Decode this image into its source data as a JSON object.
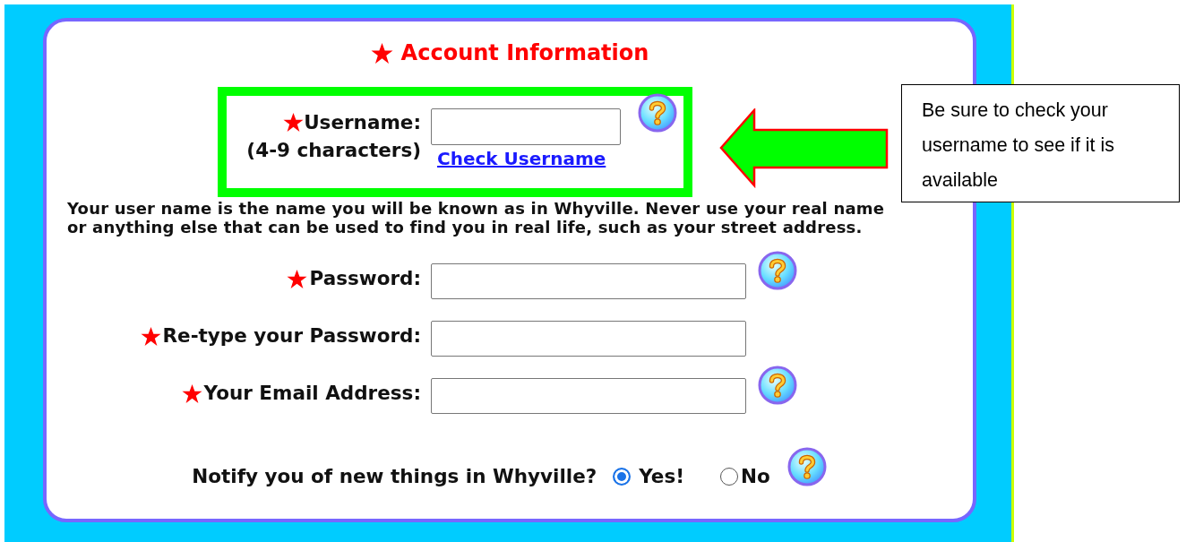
{
  "title": {
    "text": "Account Information",
    "required": true
  },
  "username": {
    "label": "Username:",
    "hint": "(4-9 characters)",
    "required": true,
    "link": "Check Username",
    "help": true
  },
  "username_note": "Your user name is the name you will be known as in Whyville. Never use your real name or anything else that can be used to find you in real life, such as your street address.",
  "fields": [
    {
      "label": "Password:",
      "required": true,
      "help": true
    },
    {
      "label": "Re-type your Password:",
      "required": true,
      "help": false
    },
    {
      "label": "Your Email Address:",
      "required": true,
      "help": true
    }
  ],
  "notify": {
    "question": "Notify you of new things in Whyville?",
    "help": true,
    "options": [
      {
        "label": "Yes!",
        "selected": true
      },
      {
        "label": "No",
        "selected": false
      }
    ]
  },
  "callout": {
    "text": "Be sure to check your username to see if it is available"
  }
}
